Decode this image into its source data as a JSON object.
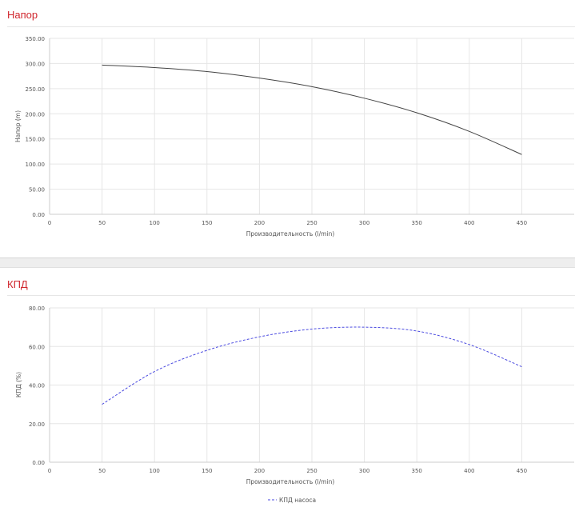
{
  "panels": {
    "head": {
      "title": "Напор"
    },
    "efficiency": {
      "title": "КПД"
    }
  },
  "colors": {
    "title": "#d0262d",
    "head_line": "#444444",
    "efficiency_line": "#4a4ae0",
    "grid": "#e6e6e6"
  },
  "chart_data": [
    {
      "type": "line",
      "title": "Напор",
      "xlabel": "Производительность (l/min)",
      "ylabel": "Напор (m)",
      "xlim": [
        0,
        500
      ],
      "ylim": [
        0,
        350
      ],
      "x_ticks": [
        "0",
        "50",
        "100",
        "150",
        "200",
        "250",
        "300",
        "350",
        "400",
        "450"
      ],
      "y_ticks": [
        "0.00",
        "50.00",
        "100.00",
        "150.00",
        "200.00",
        "250.00",
        "300.00",
        "350.00"
      ],
      "grid": true,
      "series": [
        {
          "style": "solid",
          "x": [
            50,
            100,
            150,
            200,
            250,
            300,
            350,
            400,
            450
          ],
          "y": [
            297,
            292,
            284,
            271,
            254,
            231,
            202,
            165,
            119
          ]
        }
      ]
    },
    {
      "type": "line",
      "title": "КПД",
      "xlabel": "Производительность (l/min)",
      "ylabel": "КПД (%)",
      "xlim": [
        0,
        500
      ],
      "ylim": [
        0,
        80
      ],
      "x_ticks": [
        "0",
        "50",
        "100",
        "150",
        "200",
        "250",
        "300",
        "350",
        "400",
        "450"
      ],
      "y_ticks": [
        "0.00",
        "20.00",
        "40.00",
        "60.00",
        "80.00"
      ],
      "grid": true,
      "legend": "bottom",
      "series": [
        {
          "name": "КПД насоса",
          "style": "dashed",
          "x": [
            50,
            100,
            150,
            200,
            250,
            300,
            350,
            400,
            450
          ],
          "y": [
            30,
            47,
            58,
            65,
            69,
            70,
            68,
            61,
            49.5
          ]
        }
      ]
    }
  ]
}
